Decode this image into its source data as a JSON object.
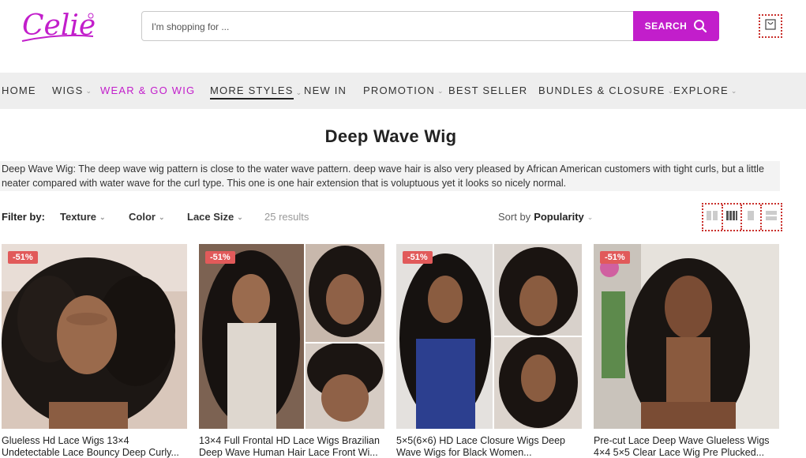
{
  "brand": {
    "logo_text": "Celie",
    "accent_color": "#c21ecb"
  },
  "search": {
    "placeholder": "I'm shopping for ...",
    "button_label": "SEARCH"
  },
  "nav": {
    "items": [
      {
        "label": "HOME",
        "has_dropdown": false
      },
      {
        "label": "WIGS",
        "has_dropdown": true
      },
      {
        "label": "WEAR & GO WIG",
        "has_dropdown": false
      },
      {
        "label": "MORE STYLES",
        "has_dropdown": true
      },
      {
        "label": "NEW IN",
        "has_dropdown": false
      },
      {
        "label": "PROMOTION",
        "has_dropdown": true
      },
      {
        "label": "BEST SELLER",
        "has_dropdown": false
      },
      {
        "label": "BUNDLES & CLOSURE",
        "has_dropdown": true
      },
      {
        "label": "EXPLORE",
        "has_dropdown": true
      }
    ]
  },
  "page": {
    "title": "Deep Wave Wig",
    "description": "Deep Wave Wig: The deep wave wig pattern is close to the water wave pattern. deep wave hair is also very pleased by African American customers with tight curls, but a little neater compared with water wave for the curl type. This one is one hair extension that is voluptuous yet it looks so nicely normal."
  },
  "filters": {
    "label": "Filter by:",
    "options": [
      "Texture",
      "Color",
      "Lace Size"
    ],
    "results": "25 results",
    "sort_prefix": "Sort by",
    "sort_value": "Popularity"
  },
  "products": [
    {
      "badge": "-51%",
      "title": "Glueless Hd Lace Wigs 13×4 Undetectable Lace Bouncy Deep Curly..."
    },
    {
      "badge": "-51%",
      "title": "13×4 Full Frontal HD Lace Wigs Brazilian Deep Wave Human Hair Lace Front Wi..."
    },
    {
      "badge": "-51%",
      "title": "5×5(6×6) HD Lace Closure Wigs Deep Wave Wigs for Black Women..."
    },
    {
      "badge": "-51%",
      "title": "Pre-cut Lace Deep Wave Glueless Wigs 4×4 5×5 Clear Lace Wig Pre Plucked..."
    }
  ]
}
